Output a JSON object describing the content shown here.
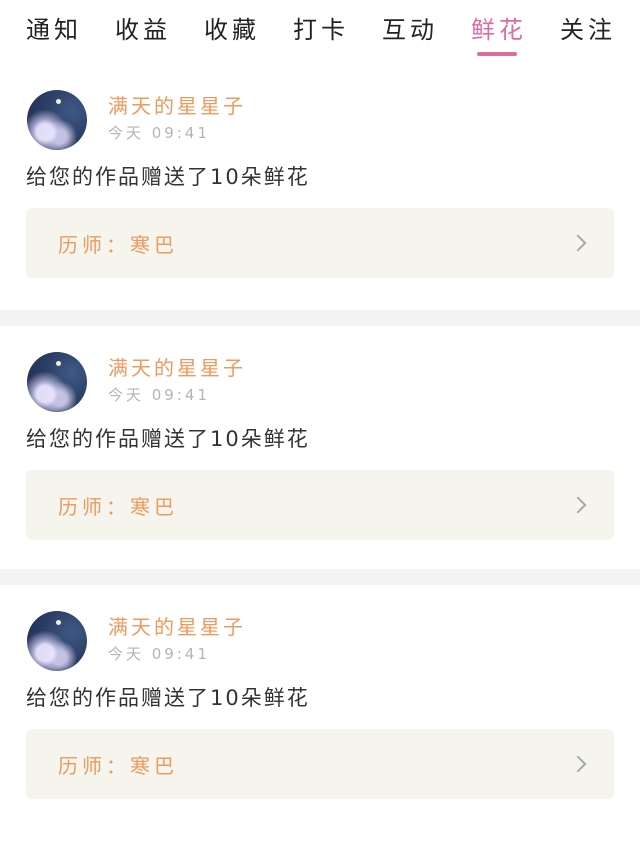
{
  "tabs": [
    {
      "label": "通知",
      "active": false
    },
    {
      "label": "收益",
      "active": false
    },
    {
      "label": "收藏",
      "active": false
    },
    {
      "label": "打卡",
      "active": false
    },
    {
      "label": "互动",
      "active": false
    },
    {
      "label": "鲜花",
      "active": true
    },
    {
      "label": "关注",
      "active": false
    }
  ],
  "accent_color": "#e06aa3",
  "name_color": "#ee9a5d",
  "items": [
    {
      "avatar_icon": "starry-night-avatar-icon",
      "username": "满天的星星子",
      "time": "今天 09:41",
      "message": "给您的作品赠送了10朵鲜花",
      "teacher_label": "历师：寒巴",
      "chevron_icon": "chevron-right-icon"
    },
    {
      "avatar_icon": "starry-night-avatar-icon",
      "username": "满天的星星子",
      "time": "今天 09:41",
      "message": "给您的作品赠送了10朵鲜花",
      "teacher_label": "历师：寒巴",
      "chevron_icon": "chevron-right-icon"
    },
    {
      "avatar_icon": "starry-night-avatar-icon",
      "username": "满天的星星子",
      "time": "今天 09:41",
      "message": "给您的作品赠送了10朵鲜花",
      "teacher_label": "历师：寒巴",
      "chevron_icon": "chevron-right-icon"
    }
  ]
}
